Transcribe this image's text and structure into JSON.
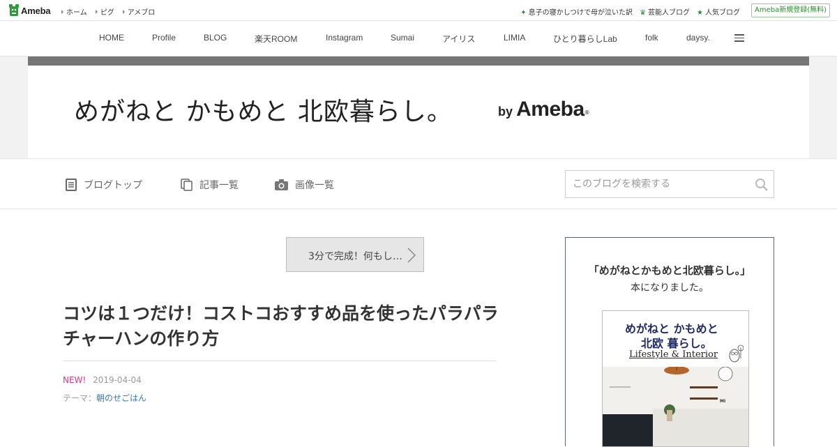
{
  "topbar": {
    "logo_text": "Ameba",
    "links": [
      "ホーム",
      "ピグ",
      "アメブロ"
    ],
    "right_links": [
      "息子の寝かしつけで母が泣いた訳",
      "芸能人ブログ",
      "人気ブログ"
    ],
    "register_label": "Ameba新規登録(無料)"
  },
  "global_nav": {
    "items": [
      "HOME",
      "Profile",
      "BLOG",
      "楽天ROOM",
      "Instagram",
      "Sumai",
      "アイリス",
      "LIMIA",
      "ひとり暮らしLab",
      "folk",
      "daysy."
    ]
  },
  "header": {
    "blog_title": "めがねと かもめと 北欧暮らし。",
    "by_label": "by",
    "ameba_label": "Ameba",
    "reg_mark": "®"
  },
  "blog_nav": {
    "top_label": "ブログトップ",
    "entries_label": "記事一覧",
    "images_label": "画像一覧",
    "search_placeholder": "このブログを検索する"
  },
  "article": {
    "prev_label": "3分で完成！何もし…",
    "title": "コツは１つだけ！コストコおすすめ品を使ったパラパラチャーハンの作り方",
    "new_label": "NEW!",
    "date": "2019-04-04",
    "theme_label": "テーマ：",
    "theme": "朝のせごはん"
  },
  "sidebar": {
    "line1": "「めがねとかもめと北欧暮らし。」",
    "line2": "本になりました。",
    "book": {
      "title_line1": "めがねと かもめと",
      "title_line2": "北欧 暮らし。",
      "subtitle": "Lifestyle & Interior",
      "author": "MI"
    }
  },
  "colors": {
    "accent_green": "#2a8a2a",
    "new_pink": "#e0338e",
    "link_blue": "#3a79b5",
    "header_band": "#767676"
  }
}
